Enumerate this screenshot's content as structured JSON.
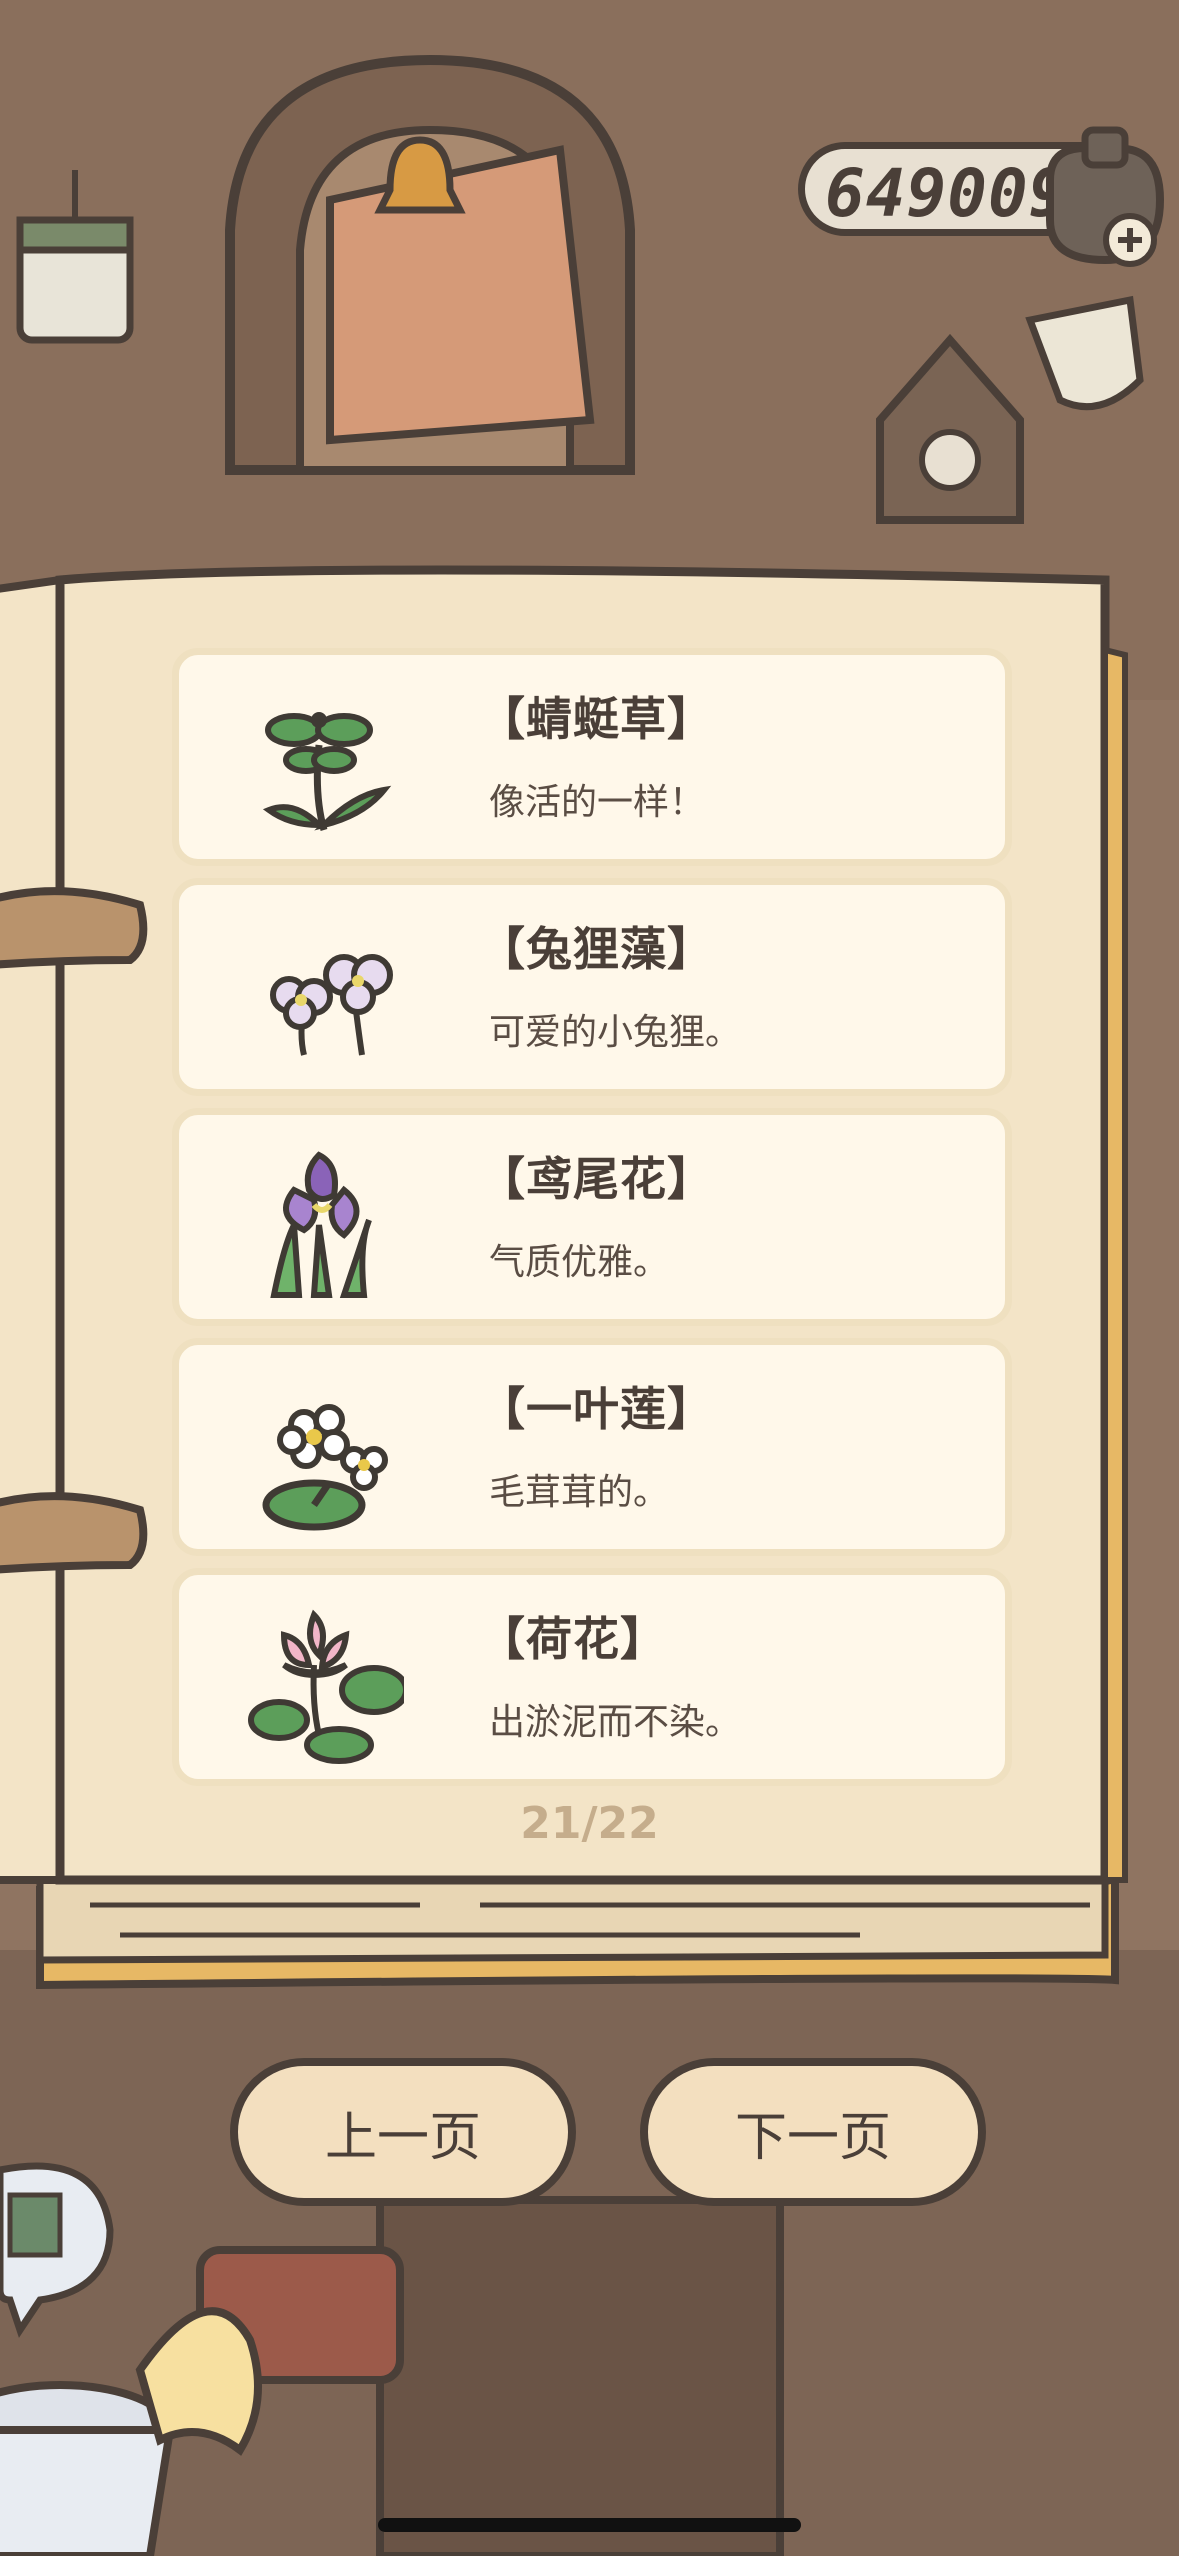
{
  "currency": {
    "value": "649009",
    "icon": "coin-bag-plus-icon"
  },
  "journal": {
    "entries": [
      {
        "title": "【蜻蜓草】",
        "description": "像活的一样！",
        "icon": "dragonfly-grass-plant-icon"
      },
      {
        "title": "【兔狸藻】",
        "description": "可爱的小兔狸。",
        "icon": "bladderwort-flower-icon"
      },
      {
        "title": "【鸢尾花】",
        "description": "气质优雅。",
        "icon": "iris-flower-icon"
      },
      {
        "title": "【一叶莲】",
        "description": "毛茸茸的。",
        "icon": "floating-heart-flower-icon"
      },
      {
        "title": "【荷花】",
        "description": "出淤泥而不染。",
        "icon": "lotus-flower-icon"
      }
    ],
    "page_indicator": "21/22"
  },
  "navigation": {
    "prev_label": "上一页",
    "next_label": "下一页"
  },
  "colors": {
    "background": "#8f7461",
    "page": "#f3e4c7",
    "card": "#fff8ea",
    "outline": "#4a3f38",
    "page_number": "#c5ad8c",
    "button": "#f3dfbf"
  }
}
